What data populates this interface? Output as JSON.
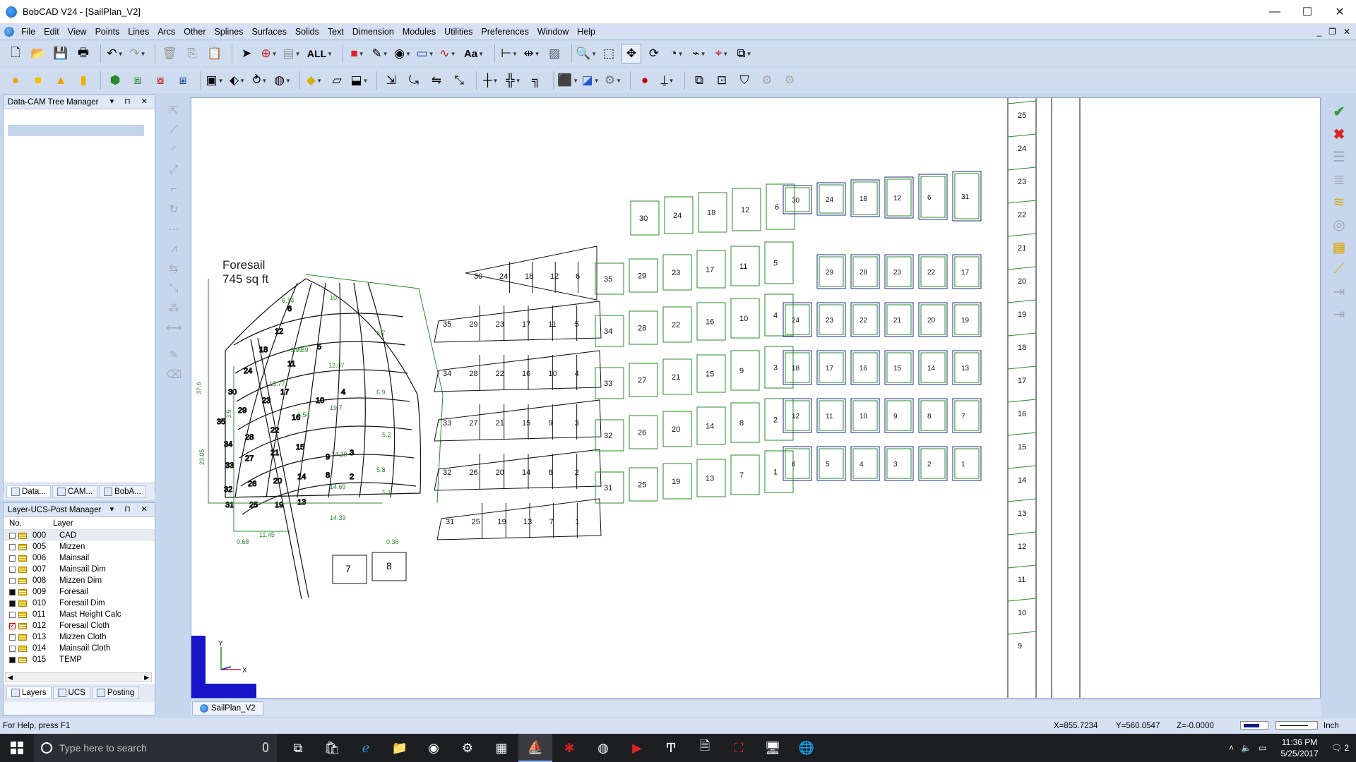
{
  "window": {
    "title": "BobCAD V24 - [SailPlan_V2]",
    "controls": {
      "minimize": "—",
      "maximize": "☐",
      "close": "✕"
    }
  },
  "menubar": {
    "items": [
      "File",
      "Edit",
      "View",
      "Points",
      "Lines",
      "Arcs",
      "Other",
      "Splines",
      "Surfaces",
      "Solids",
      "Text",
      "Dimension",
      "Modules",
      "Utilities",
      "Preferences",
      "Window",
      "Help"
    ],
    "mdi_controls": [
      "_",
      "❐",
      "✕"
    ]
  },
  "toolbar1": {
    "select_all_label": "ALL",
    "text_tool_label": "Aa"
  },
  "tree_manager": {
    "title": "Data-CAM Tree Manager",
    "tabs": [
      "Data...",
      "CAM...",
      "BobA..."
    ]
  },
  "layer_manager": {
    "title": "Layer-UCS-Post Manager",
    "col_no": "No.",
    "col_layer": "Layer",
    "rows": [
      {
        "num": "000",
        "name": "CAD",
        "state": "none"
      },
      {
        "num": "005",
        "name": "Mizzen",
        "state": "none"
      },
      {
        "num": "006",
        "name": "Mainsail",
        "state": "none"
      },
      {
        "num": "007",
        "name": "Mainsail Dim",
        "state": "none"
      },
      {
        "num": "008",
        "name": "Mizzen Dim",
        "state": "none"
      },
      {
        "num": "009",
        "name": "Foresail",
        "state": "on"
      },
      {
        "num": "010",
        "name": "Foresail Dim",
        "state": "on"
      },
      {
        "num": "011",
        "name": "Mast Height Calc",
        "state": "none"
      },
      {
        "num": "012",
        "name": "Foresail Cloth",
        "state": "current"
      },
      {
        "num": "013",
        "name": "Mizzen Cloth",
        "state": "none"
      },
      {
        "num": "014",
        "name": "Mainsail Cloth",
        "state": "none"
      },
      {
        "num": "015",
        "name": "TEMP",
        "state": "on"
      }
    ],
    "tabs": [
      "Layers",
      "UCS",
      "Posting"
    ]
  },
  "canvas": {
    "sail_title": "Foresail",
    "sail_area": "745 sq ft",
    "axis_x": "X",
    "axis_y": "Y",
    "dims": [
      "37.6",
      "7.89",
      "6.14",
      "12.07",
      "15.77",
      "19.7",
      "14.29",
      "14.69",
      "14.39",
      "11.45",
      "0.68",
      "23.05",
      "3.5",
      "6.7",
      "5.2",
      "5.1",
      "0.36",
      "6.09",
      "6.54",
      "10",
      "6.9",
      "5.8"
    ],
    "bands_a": [
      [
        "30",
        "24",
        "18",
        "12",
        "6"
      ],
      [
        "35",
        "29",
        "23",
        "17",
        "11",
        "5"
      ],
      [
        "34",
        "28",
        "22",
        "16",
        "10",
        "4"
      ],
      [
        "33",
        "27",
        "21",
        "15",
        "9",
        "3"
      ],
      [
        "32",
        "26",
        "20",
        "14",
        "8",
        "2"
      ],
      [
        "31",
        "25",
        "19",
        "13",
        "7",
        "1"
      ]
    ],
    "grid_b": [
      [
        "30",
        "24",
        "18",
        "12",
        "6"
      ],
      [
        "35",
        "29",
        "23",
        "17",
        "11",
        "5"
      ],
      [
        "34",
        "28",
        "22",
        "16",
        "10",
        "4"
      ],
      [
        "33",
        "27",
        "21",
        "15",
        "9",
        "3"
      ],
      [
        "32",
        "26",
        "20",
        "14",
        "8",
        "2"
      ],
      [
        "31",
        "25",
        "19",
        "13",
        "7",
        "1"
      ]
    ],
    "grid_c": [
      [
        "30",
        "24",
        "18",
        "12",
        "6",
        "31"
      ],
      [
        "",
        "29",
        "28",
        "23",
        "22",
        "17"
      ],
      [
        "24",
        "23",
        "22",
        "21",
        "20",
        "19"
      ],
      [
        "18",
        "17",
        "16",
        "15",
        "14",
        "13"
      ],
      [
        "12",
        "11",
        "10",
        "9",
        "8",
        "7"
      ],
      [
        "6",
        "5",
        "4",
        "3",
        "2",
        "1"
      ]
    ],
    "strip": [
      "25",
      "24",
      "23",
      "22",
      "21",
      "20",
      "19",
      "18",
      "17",
      "16",
      "15",
      "14",
      "13",
      "12",
      "11",
      "10",
      "9"
    ],
    "small_parts": [
      "7",
      "8"
    ]
  },
  "doc_tab": {
    "label": "SailPlan_V2"
  },
  "status": {
    "help": "For Help, press F1",
    "x": "X=855.7234",
    "y": "Y=560.0547",
    "z": "Z=-0.0000",
    "units": "Inch"
  },
  "taskbar": {
    "search_placeholder": "Type here to search",
    "time": "11:36 PM",
    "date": "5/25/2017",
    "notification_count": "2"
  },
  "colors": {
    "cloth_green": "#2a8a2a",
    "accent": "#1a3c9a"
  }
}
